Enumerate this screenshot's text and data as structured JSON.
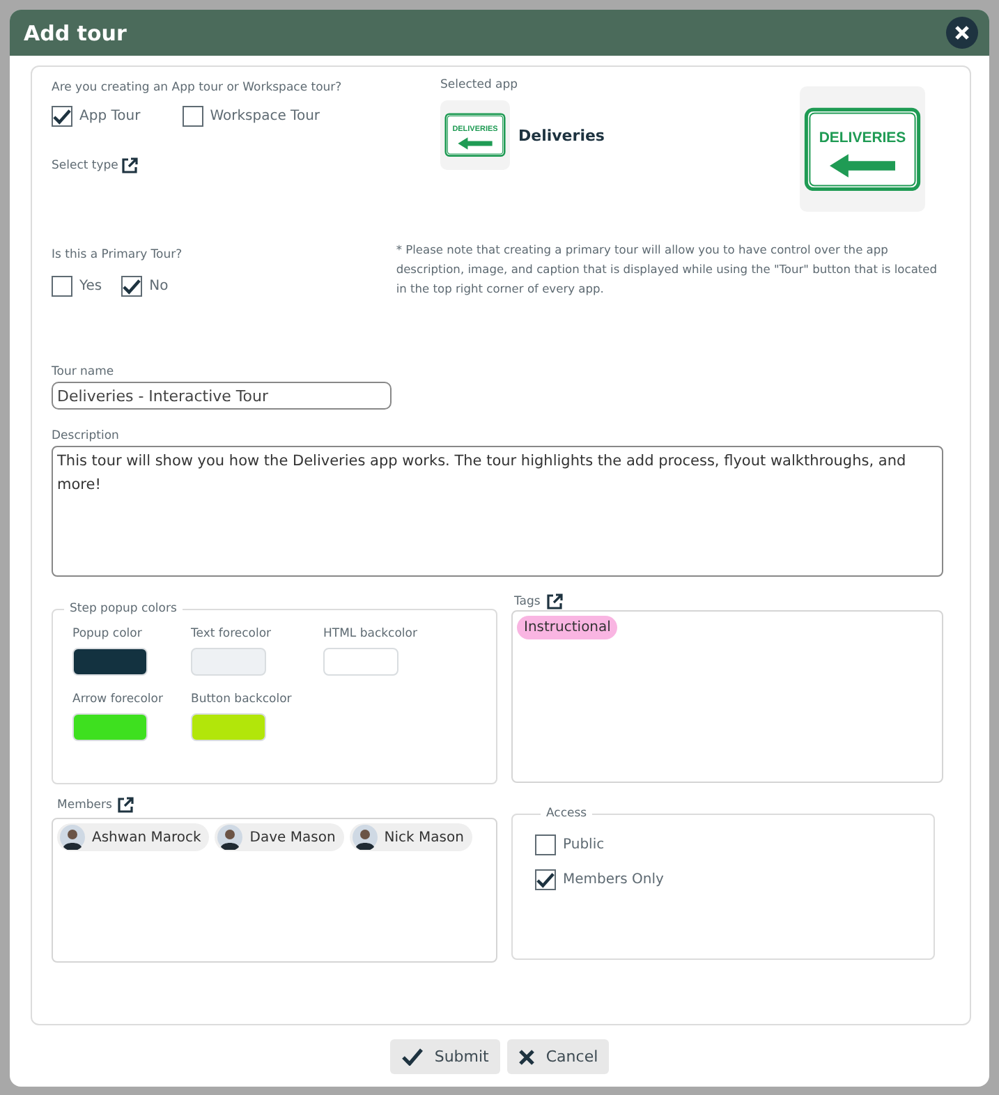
{
  "dialog": {
    "title": "Add tour"
  },
  "tour_type": {
    "question": "Are you creating an App tour or Workspace tour?",
    "options": [
      {
        "label": "App Tour",
        "checked": true
      },
      {
        "label": "Workspace Tour",
        "checked": false
      }
    ],
    "select_type_label": "Select type"
  },
  "selected_app": {
    "label": "Selected app",
    "name": "Deliveries",
    "icon_text": "DELIVERIES",
    "preview_text": "DELIVERIES"
  },
  "primary_tour": {
    "question": "Is this a Primary Tour?",
    "options": [
      {
        "label": "Yes",
        "checked": false
      },
      {
        "label": "No",
        "checked": true
      }
    ],
    "note": "* Please note that creating a primary tour will allow you to have control over the app description, image, and caption that is displayed while using the \"Tour\" button that is located in the top right corner of every app."
  },
  "tour_name": {
    "label": "Tour name",
    "value": "Deliveries - Interactive Tour"
  },
  "description": {
    "label": "Description",
    "value": "This tour will show you how the Deliveries app works. The tour highlights the add process, flyout walkthroughs, and more!"
  },
  "step_popup_colors": {
    "legend": "Step popup colors",
    "swatches": [
      {
        "label": "Popup color",
        "color": "#133240"
      },
      {
        "label": "Text forecolor",
        "color": "#eef1f4"
      },
      {
        "label": "HTML backcolor",
        "color": "#ffffff"
      },
      {
        "label": "Arrow forecolor",
        "color": "#3ee01f"
      },
      {
        "label": "Button backcolor",
        "color": "#b2e60a"
      }
    ]
  },
  "tags": {
    "label": "Tags",
    "items": [
      {
        "label": "Instructional",
        "color": "#f9b5e2"
      }
    ]
  },
  "members": {
    "label": "Members",
    "items": [
      {
        "name": "Ashwan Marock"
      },
      {
        "name": "Dave Mason"
      },
      {
        "name": "Nick Mason"
      }
    ]
  },
  "access": {
    "legend": "Access",
    "options": [
      {
        "label": "Public",
        "checked": false
      },
      {
        "label": "Members Only",
        "checked": true
      }
    ]
  },
  "buttons": [
    {
      "label": "Submit",
      "kind": "submit"
    },
    {
      "label": "Cancel",
      "kind": "cancel"
    }
  ]
}
